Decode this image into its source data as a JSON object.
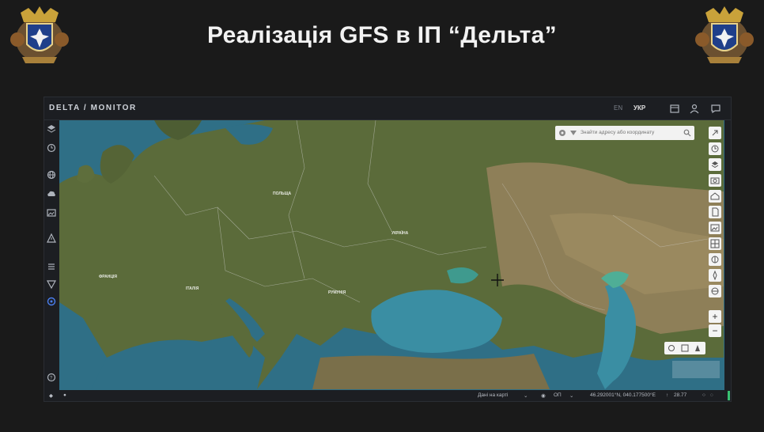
{
  "slide": {
    "title": "Реалізація GFS в ІП “Дельта”"
  },
  "app": {
    "title": "DELTA / MONITOR",
    "languages": [
      "EN",
      "УКР"
    ],
    "active_language": "УКР",
    "search": {
      "placeholder": "Знайти адресу або координату"
    },
    "bottom_bar": {
      "basemap_label": "Дані на карті",
      "layers_value": "ОП",
      "coordinates": "46.292001°N, 040.177500°E",
      "zoom_value": "28.77"
    },
    "map_labels": [
      "ІТАЛІЯ",
      "УКРАЇНА",
      "ФРАНЦІЯ",
      "ПОЛЬЩА",
      "РУМУНІЯ"
    ],
    "colors": {
      "background": "#1a1a1a",
      "panel": "#1c1e22",
      "water": "#2f6f86",
      "land": "#5b6b3a",
      "steppe": "#8e7f58",
      "accent_green": "#38c172"
    }
  },
  "icons": {
    "sidebar": [
      "layers-icon",
      "history-icon",
      "globe-icon",
      "cloud-icon",
      "image-icon",
      "warning-icon",
      "list-icon",
      "filter-icon",
      "target-icon",
      "help-icon"
    ],
    "topbar": [
      "calendar-icon",
      "user-icon",
      "chat-icon"
    ],
    "map_tools": [
      "share-icon",
      "clock-icon",
      "layers-icon",
      "camera-icon",
      "home-icon",
      "document-icon",
      "image-icon",
      "grid-icon",
      "measure-icon",
      "compass-icon",
      "route-icon"
    ]
  }
}
